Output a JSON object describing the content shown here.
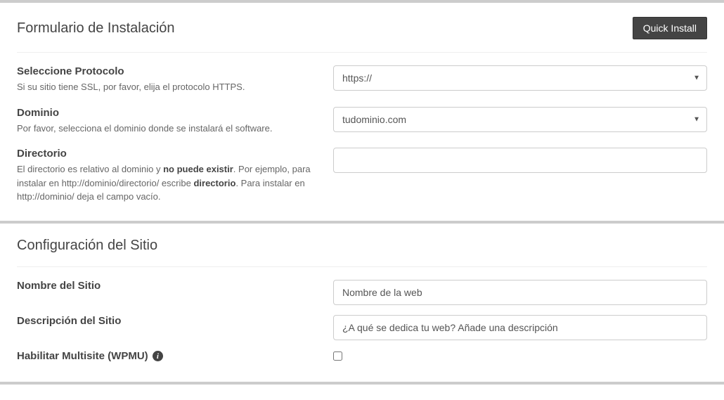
{
  "install": {
    "title": "Formulario de Instalación",
    "quick_install": "Quick Install",
    "protocol": {
      "label": "Seleccione Protocolo",
      "help": "Si su sitio tiene SSL, por favor, elija el protocolo HTTPS.",
      "value": "https://"
    },
    "domain": {
      "label": "Dominio",
      "help": "Por favor, selecciona el dominio donde se instalará el software.",
      "value": "tudominio.com"
    },
    "directory": {
      "label": "Directorio",
      "help_pre": "El directorio es relativo al dominio y ",
      "help_bold1": "no puede existir",
      "help_mid": ". Por ejemplo, para instalar en http://dominio/directorio/ escribe ",
      "help_bold2": "directorio",
      "help_post": ". Para instalar en http://dominio/ deja el campo vacío.",
      "value": ""
    }
  },
  "site": {
    "title": "Configuración del Sitio",
    "name": {
      "label": "Nombre del Sitio",
      "value": "Nombre de la web"
    },
    "description": {
      "label": "Descripción del Sitio",
      "value": "¿A qué se dedica tu web? Añade una descripción"
    },
    "multisite": {
      "label": "Habilitar Multisite (WPMU) "
    }
  }
}
